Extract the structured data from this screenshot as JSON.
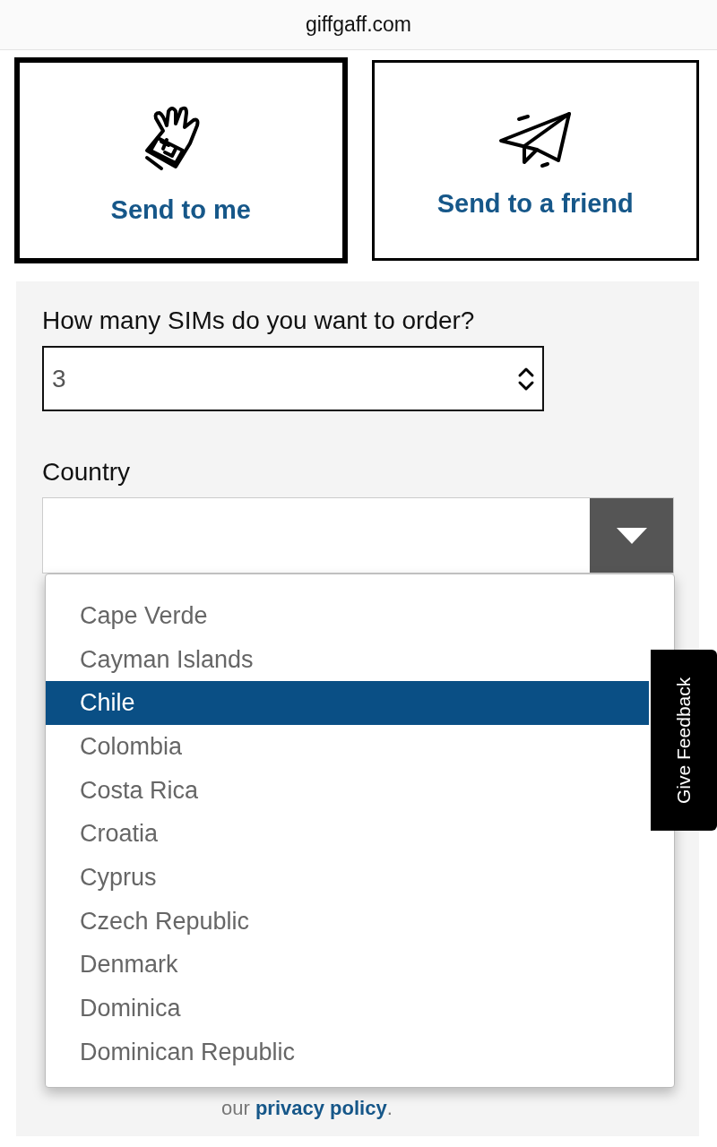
{
  "browser": {
    "url": "giffgaff.com"
  },
  "delivery_options": [
    {
      "label": "Send to me",
      "kind": "glove",
      "selected": true
    },
    {
      "label": "Send to a friend",
      "kind": "plane",
      "selected": false
    }
  ],
  "sim_quantity": {
    "label": "How many SIMs do you want to order?",
    "value": "3"
  },
  "country": {
    "label": "Country",
    "options": [
      {
        "label": "Cape Verde",
        "selected": false
      },
      {
        "label": "Cayman Islands",
        "selected": false
      },
      {
        "label": "Chile",
        "selected": true
      },
      {
        "label": "Colombia",
        "selected": false
      },
      {
        "label": "Costa Rica",
        "selected": false
      },
      {
        "label": "Croatia",
        "selected": false
      },
      {
        "label": "Cyprus",
        "selected": false
      },
      {
        "label": "Czech Republic",
        "selected": false
      },
      {
        "label": "Denmark",
        "selected": false
      },
      {
        "label": "Dominica",
        "selected": false
      },
      {
        "label": "Dominican Republic",
        "selected": false
      }
    ]
  },
  "privacy": {
    "prefix": "our",
    "link": "privacy policy",
    "suffix": "."
  },
  "feedback_tab": "Give Feedback"
}
